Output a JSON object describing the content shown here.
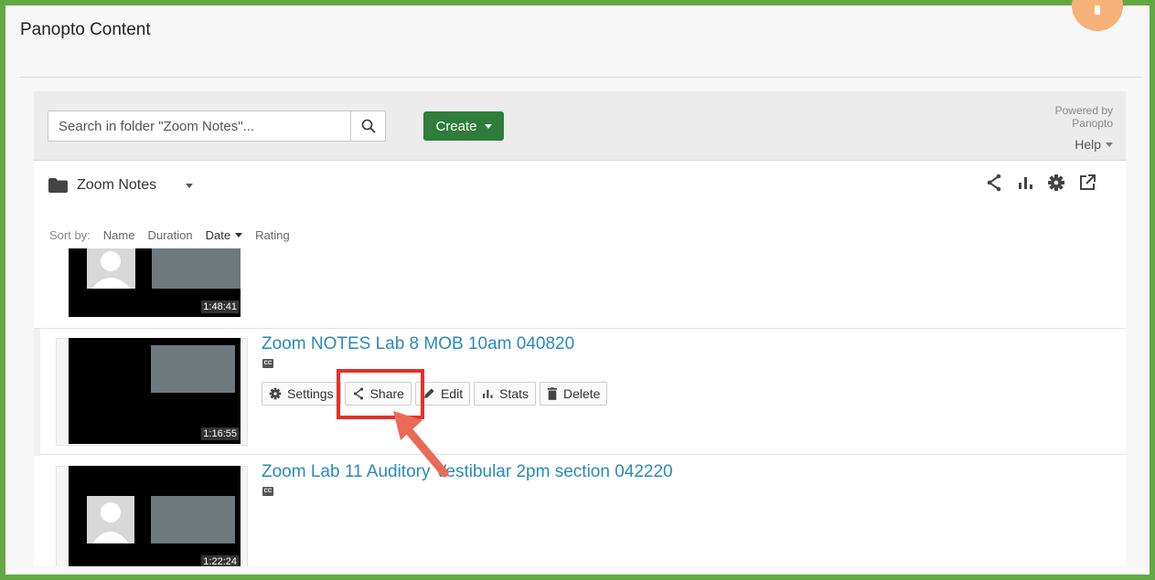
{
  "panel": {
    "title": "Panopto Content"
  },
  "toolbar": {
    "search_placeholder": "Search in folder \"Zoom Notes\"...",
    "search_value": "",
    "create_label": "Create",
    "powered_line1": "Powered by",
    "powered_line2": "Panopto",
    "help_label": "Help"
  },
  "folder": {
    "name": "Zoom Notes"
  },
  "folder_tools": [
    "share-icon",
    "stats-icon",
    "settings-icon",
    "open-external-icon"
  ],
  "sort": {
    "label": "Sort by:",
    "options": [
      "Name",
      "Duration",
      "Date",
      "Rating"
    ],
    "active": "Date"
  },
  "sessions": [
    {
      "title": "",
      "duration": "1:48:41"
    },
    {
      "title": "Zoom NOTES Lab 8 MOB 10am 040820",
      "duration": "1:16:55",
      "cc": "CC"
    },
    {
      "title": "Zoom Lab 11 Auditory Vestibular 2pm section 042220",
      "duration": "1:22:24",
      "cc": "CC"
    }
  ],
  "actions": {
    "settings_label": "Settings",
    "share_label": "Share",
    "edit_label": "Edit",
    "stats_label": "Stats",
    "delete_label": "Delete"
  },
  "colors": {
    "frame_border": "#64a844",
    "create_button": "#2e7d3a",
    "title_link": "#2a8ab8",
    "highlight": "#e5302a",
    "notification": "#f7b27a"
  }
}
